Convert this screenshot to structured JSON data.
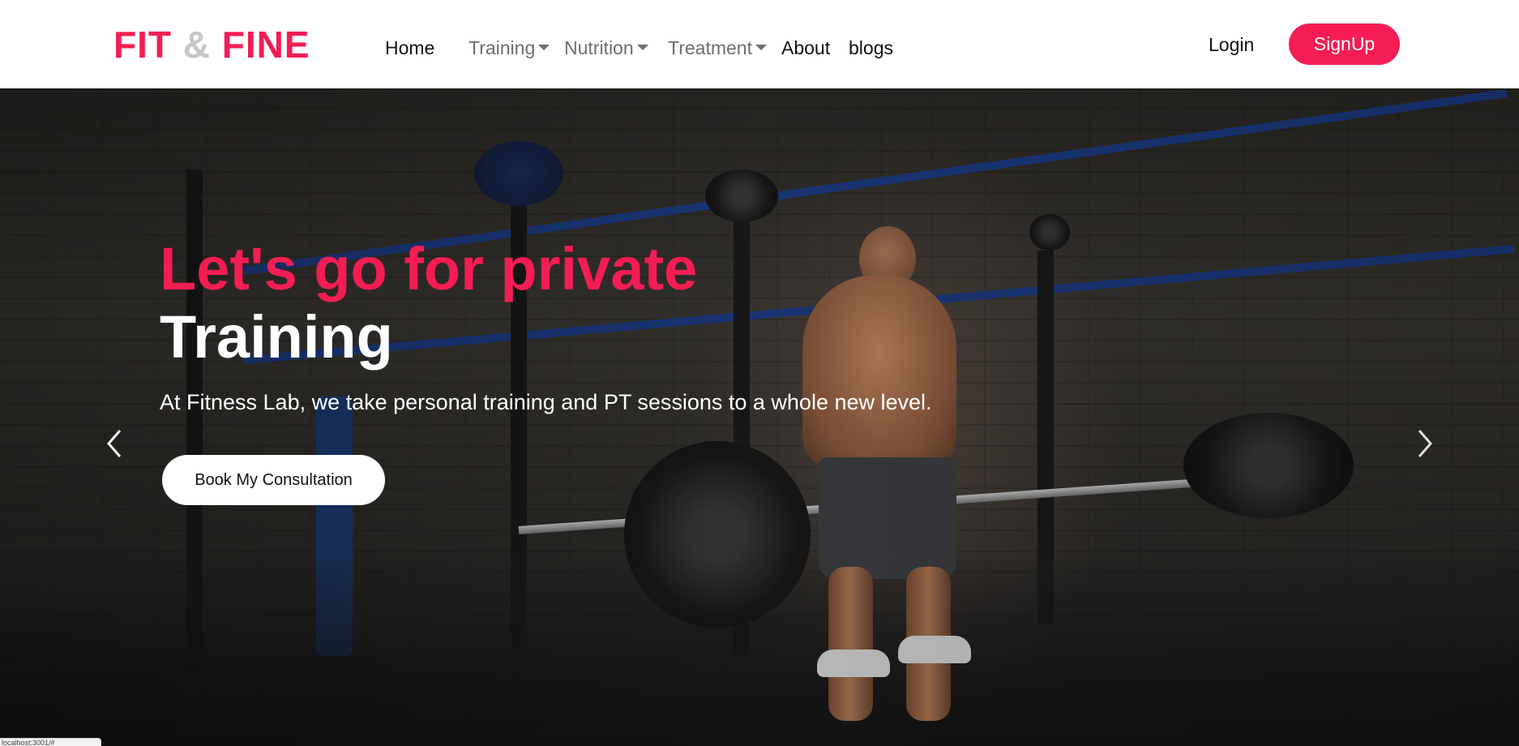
{
  "brand": {
    "part1": "FIT",
    "amp": "&",
    "part2": "FINE"
  },
  "nav": {
    "home": "Home",
    "training": "Training",
    "nutrition": "Nutrition",
    "treatment": "Treatment",
    "about": "About",
    "blogs": "blogs"
  },
  "auth": {
    "login": "Login",
    "signup": "SignUp"
  },
  "hero": {
    "headline_red": "Let's go for private",
    "headline_white": "Training",
    "subtitle": "At Fitness Lab, we take personal training and PT sessions to a whole new level.",
    "cta": "Book My Consultation",
    "prev_icon": "chevron-left-icon",
    "next_icon": "chevron-right-icon"
  },
  "status": {
    "text": "localhost:3001/#"
  },
  "colors": {
    "accent": "#f31d53",
    "ampersand": "#c6c6c6",
    "dropdown_text": "#6e6e6e"
  }
}
